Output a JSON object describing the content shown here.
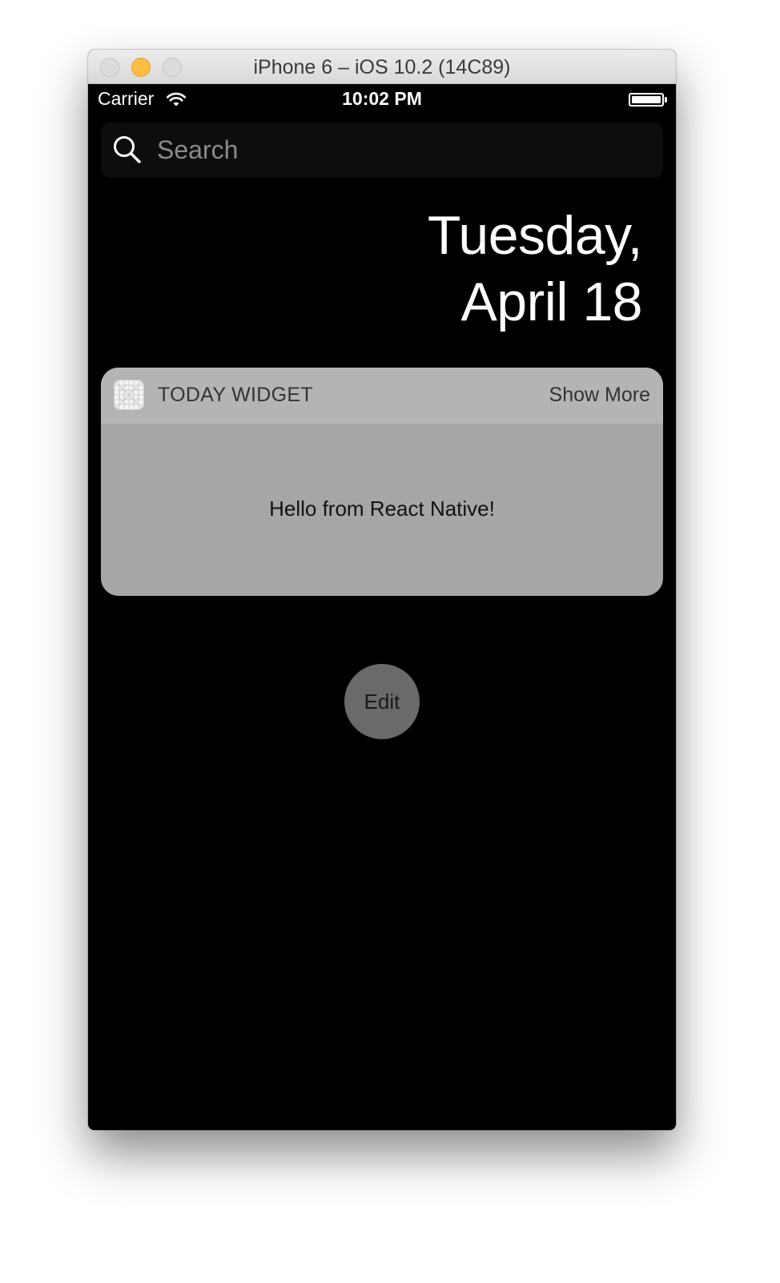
{
  "window": {
    "title": "iPhone 6 – iOS 10.2 (14C89)"
  },
  "status_bar": {
    "carrier": "Carrier",
    "time": "10:02 PM"
  },
  "search": {
    "placeholder": "Search"
  },
  "date": {
    "line1": "Tuesday,",
    "line2": "April 18"
  },
  "widget": {
    "title": "TODAY WIDGET",
    "show_more_label": "Show More",
    "message": "Hello from React Native!"
  },
  "edit_button": {
    "label": "Edit"
  },
  "icons": {
    "search": "search-icon",
    "wifi": "wifi-icon",
    "battery": "battery-icon",
    "app": "app-icon"
  },
  "colors": {
    "screen_background": "#000000",
    "widget_header": "#b4b4b4",
    "widget_body": "#a6a6a6",
    "edit_button": "#6a6a6a",
    "minimize_button": "#fdbd41"
  }
}
